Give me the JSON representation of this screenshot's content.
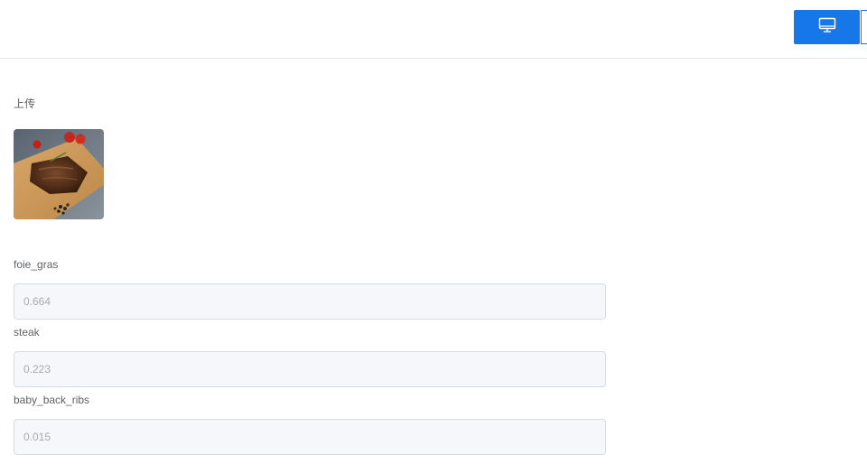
{
  "header": {
    "view_button_icon": "desktop-monitor-icon",
    "accent_color": "#1677e8"
  },
  "upload": {
    "label": "上传",
    "image_icon": "steak-photo"
  },
  "results": [
    {
      "label": "foie_gras",
      "value": "0.664"
    },
    {
      "label": "steak",
      "value": "0.223"
    },
    {
      "label": "baby_back_ribs",
      "value": "0.015"
    }
  ]
}
